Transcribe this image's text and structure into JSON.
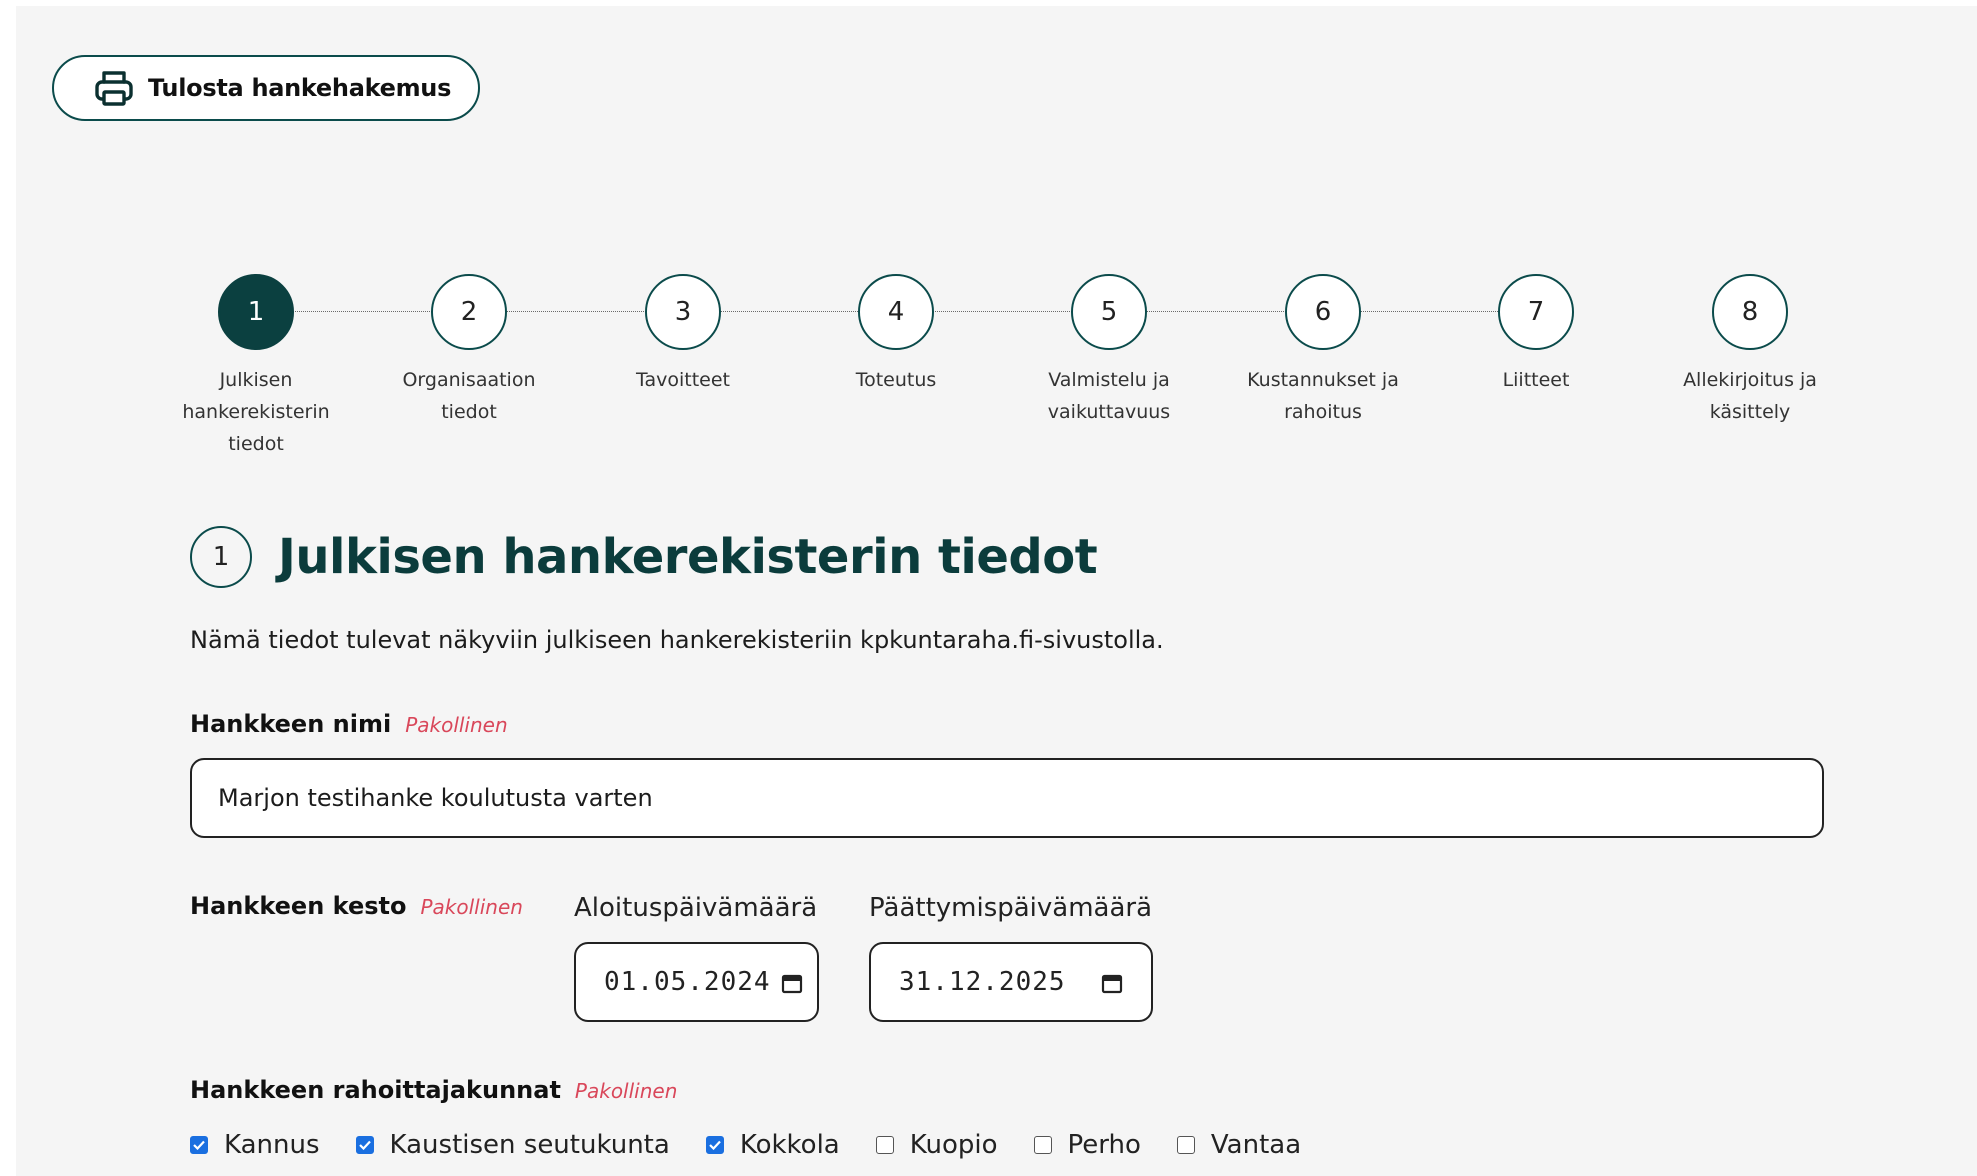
{
  "print_button": {
    "label": "Tulosta hankehakemus",
    "icon": "printer-icon"
  },
  "stepper": {
    "active_step": 1,
    "steps": [
      {
        "number": "1",
        "label": "Julkisen hankerekisterin tiedot"
      },
      {
        "number": "2",
        "label": "Organisaation tiedot"
      },
      {
        "number": "3",
        "label": "Tavoitteet"
      },
      {
        "number": "4",
        "label": "Toteutus"
      },
      {
        "number": "5",
        "label": "Valmistelu ja vaikuttavuus"
      },
      {
        "number": "6",
        "label": "Kustannukset ja rahoitus"
      },
      {
        "number": "7",
        "label": "Liitteet"
      },
      {
        "number": "8",
        "label": "Allekirjoitus ja käsittely"
      }
    ]
  },
  "section": {
    "number": "1",
    "title": "Julkisen hankerekisterin tiedot",
    "description": "Nämä tiedot tulevat näkyviin julkiseen hankerekisteriin kpkuntaraha.fi-sivustolla."
  },
  "fields": {
    "required_text": "Pakollinen",
    "project_name": {
      "label": "Hankkeen nimi",
      "value": "Marjon testihanke koulutusta varten"
    },
    "duration": {
      "label": "Hankkeen kesto",
      "start_label": "Aloituspäivämäärä",
      "start_value": "01.05.2024",
      "end_label": "Päättymispäivämäärä",
      "end_value": "31.12.2025"
    },
    "funders": {
      "label": "Hankkeen rahoittajakunnat",
      "options": [
        {
          "label": "Kannus",
          "checked": true
        },
        {
          "label": "Kaustisen seutukunta",
          "checked": true
        },
        {
          "label": "Kokkola",
          "checked": true
        },
        {
          "label": "Kuopio",
          "checked": false
        },
        {
          "label": "Perho",
          "checked": false
        },
        {
          "label": "Vantaa",
          "checked": false
        }
      ]
    }
  },
  "colors": {
    "primary": "#0b4040",
    "required": "#d9475a",
    "checkbox": "#1a6fe0",
    "background": "#f5f5f5"
  }
}
